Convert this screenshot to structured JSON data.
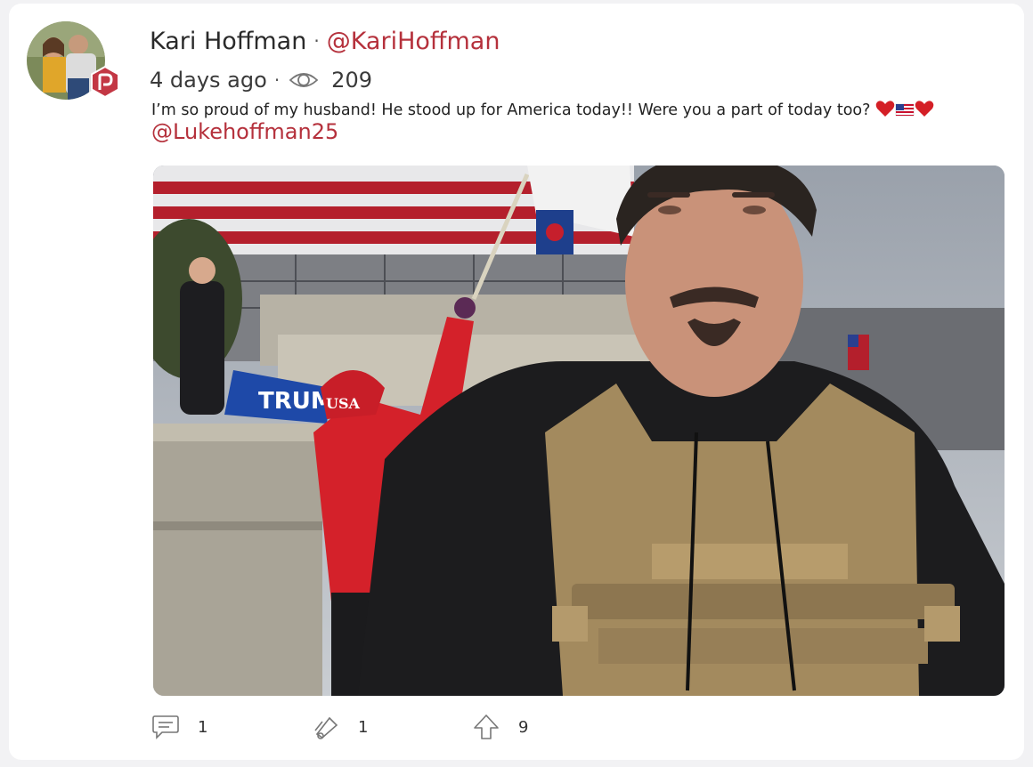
{
  "post": {
    "author_name": "Kari Hoffman",
    "separator": "·",
    "author_handle": "@KariHoffman",
    "time": "4 days ago",
    "views": "209",
    "text": "I’m so proud of my husband! He stood up for America today!! Were you a part of today too?",
    "emojis": [
      "red-heart",
      "us-flag",
      "red-heart"
    ],
    "mention": "@Lukehoffman25",
    "photo_signs": [
      "USA",
      "TRUMP"
    ]
  },
  "actions": {
    "comments": "1",
    "echoes": "1",
    "upvotes": "9"
  },
  "colors": {
    "accent": "#b5313c",
    "badge": "#c33744",
    "text": "#2a2a2a"
  },
  "icons": [
    "eye-icon",
    "comment-icon",
    "echo-icon",
    "upvote-icon",
    "parler-badge-icon"
  ]
}
